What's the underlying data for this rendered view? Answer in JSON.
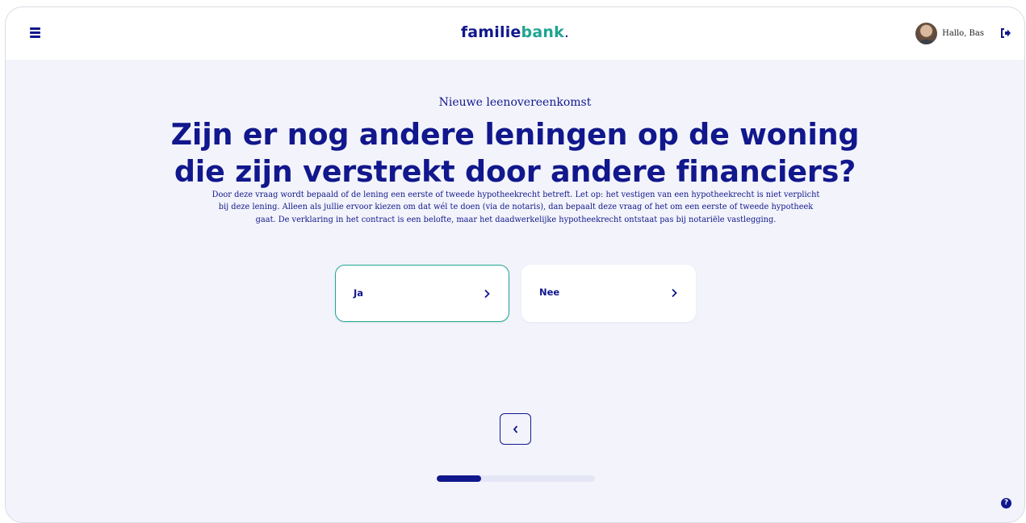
{
  "header": {
    "logo_main": "familie",
    "logo_accent": "bank",
    "logo_dot": ".",
    "greeting": "Hallo, Bas",
    "menu_icon": "hamburger-menu-icon",
    "logout_icon": "logout-icon"
  },
  "main": {
    "eyebrow": "Nieuwe leenovereenkomst",
    "question_line1": "Zijn er nog andere leningen op de woning",
    "question_line2": "die zijn verstrekt door andere financiers?",
    "description": "Door deze vraag wordt bepaald of de lening een eerste of tweede hypotheekrecht betreft. Let op: het vestigen van een hypotheekrecht is niet verplicht bij deze lening. Alleen als jullie ervoor kiezen om dat wél te doen (via de notaris), dan bepaalt deze vraag of het om een eerste of tweede hypotheek gaat. De verklaring in het contract is een belofte, maar het daadwerkelijke hypotheekrecht ontstaat pas bij notariële vastlegging.",
    "options": [
      {
        "label": "Ja",
        "selected": true
      },
      {
        "label": "Nee",
        "selected": false
      }
    ]
  },
  "navigation": {
    "back_icon": "chevron-left-icon",
    "progress_fraction": 0.28
  },
  "help": {
    "label": "?"
  },
  "colors": {
    "primary": "#11178c",
    "accent": "#1fa591",
    "background": "#f3f4fb"
  }
}
